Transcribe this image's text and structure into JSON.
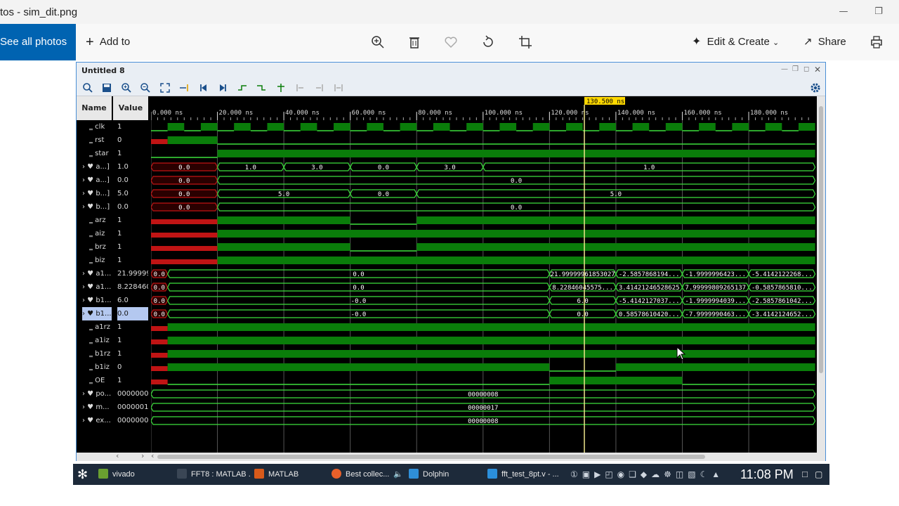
{
  "window": {
    "title": "tos - sim_dit.png"
  },
  "toolbar": {
    "see_all": "See all photos",
    "add_to": "Add to",
    "edit_create": "Edit & Create",
    "share": "Share"
  },
  "vivado": {
    "title": "Untitled 8",
    "header": {
      "name": "Name",
      "value": "Value"
    },
    "cursor_label": "130.500 ns",
    "time_ticks": [
      "0.000 ns",
      "20.000 ns",
      "40.000 ns",
      "60.000 ns",
      "80.000 ns",
      "100.000 ns",
      "120.000 ns",
      "140.000 ns",
      "160.000 ns",
      "180.000 ns"
    ],
    "signals": [
      {
        "name": "clk",
        "value": "1"
      },
      {
        "name": "rst",
        "value": "0"
      },
      {
        "name": "star",
        "value": "1"
      },
      {
        "name": "a...]",
        "value": "1.0"
      },
      {
        "name": "a...]",
        "value": "0.0"
      },
      {
        "name": "b...]",
        "value": "5.0"
      },
      {
        "name": "b...]",
        "value": "0.0"
      },
      {
        "name": "arz",
        "value": "1"
      },
      {
        "name": "aiz",
        "value": "1"
      },
      {
        "name": "brz",
        "value": "1"
      },
      {
        "name": "biz",
        "value": "1"
      },
      {
        "name": "a1...",
        "value": "21.99999"
      },
      {
        "name": "a1...",
        "value": "8.228460"
      },
      {
        "name": "b1...",
        "value": "6.0"
      },
      {
        "name": "b1...",
        "value": "0.0"
      },
      {
        "name": "a1rz",
        "value": "1"
      },
      {
        "name": "a1iz",
        "value": "1"
      },
      {
        "name": "b1rz",
        "value": "1"
      },
      {
        "name": "b1iz",
        "value": "0"
      },
      {
        "name": "OE",
        "value": "1"
      },
      {
        "name": "po...",
        "value": "00000008"
      },
      {
        "name": "m...",
        "value": "00000017"
      },
      {
        "name": "ex...",
        "value": "00000008"
      }
    ],
    "bus_labels": {
      "r3": [
        "0.0",
        "1.0",
        "3.0",
        "0.0",
        "3.0",
        "1.0"
      ],
      "r4": [
        "0.0",
        "0.0"
      ],
      "r5": [
        "0.0",
        "5.0",
        "0.0",
        "5.0"
      ],
      "r6": [
        "0.0",
        "0.0"
      ],
      "r11": [
        "0.0",
        "0.0",
        "21.99999961853027",
        "-2.5857868194...",
        "-1.9999996423...",
        "-5.4142122268..."
      ],
      "r12": [
        "0.0",
        "0.0",
        "8.22846045575...",
        "3.41421246528625",
        "7.99999809265137",
        "-0.5857865810..."
      ],
      "r13": [
        "0.0",
        "-0.0",
        "6.0",
        "-5.4142127037...",
        "-1.9999994039...",
        "-2.5857861042..."
      ],
      "r14": [
        "0.0",
        "-0.0",
        "0.0",
        "0.58578610420...",
        "-7.9999990463...",
        "-3.4142124652..."
      ],
      "r20": [
        "00000008"
      ],
      "r21": [
        "00000017"
      ],
      "r22": [
        "00000008"
      ]
    }
  },
  "taskbar": {
    "items": [
      "vivado",
      "FFT8 : MATLAB ...",
      "MATLAB",
      "Best collec...",
      "Dolphin",
      "fft_test_8pt.v - ..."
    ],
    "clock": "11:08 PM"
  },
  "colors": {
    "accent": "#0063b1",
    "wave_green": "#0a7d0a",
    "bus_line": "#3ce03c",
    "cursor": "#f0e68c",
    "red": "#c01414"
  }
}
